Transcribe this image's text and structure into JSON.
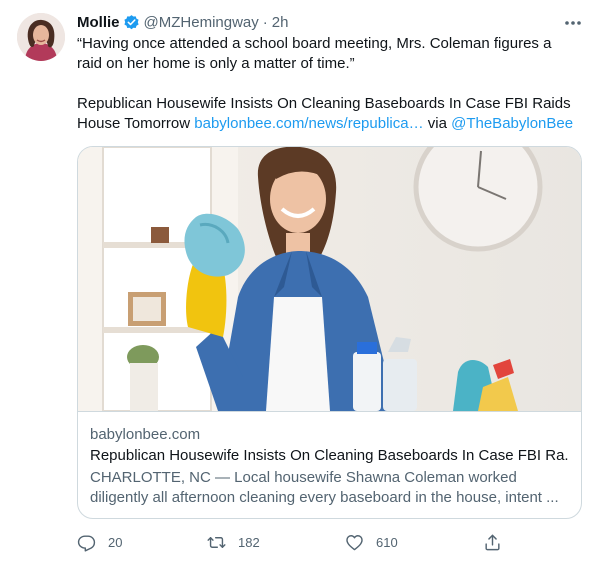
{
  "tweet": {
    "author_name": "Mollie",
    "handle": "@MZHemingway",
    "separator": "·",
    "time": "2h",
    "text_line1": "“Having once attended a school board meeting, Mrs. Coleman figures a raid on her home is only a matter of time.”",
    "text_line2_prefix": "Republican Housewife Insists On Cleaning Baseboards In Case FBI Raids House Tomorrow ",
    "text_line2_link": "babylonbee.com/news/republica…",
    "text_line2_via": " via ",
    "text_line2_mention": "@TheBabylonBee"
  },
  "card": {
    "domain": "babylonbee.com",
    "title": "Republican Housewife Insists On Cleaning Baseboards In Case FBI Ra...",
    "description_line1": "CHARLOTTE, NC — Local housewife Shawna Coleman worked",
    "description_line2": "diligently all afternoon cleaning every baseboard in the house, intent ..."
  },
  "actions": {
    "reply_count": "20",
    "retweet_count": "182",
    "like_count": "610"
  },
  "colors": {
    "link": "#1d9bf0",
    "secondary_text": "#536471",
    "border": "#cfd9de",
    "verified": "#1d9bf0"
  },
  "icons": [
    "verified-badge-icon",
    "more-icon",
    "reply-icon",
    "retweet-icon",
    "like-icon",
    "share-icon"
  ]
}
